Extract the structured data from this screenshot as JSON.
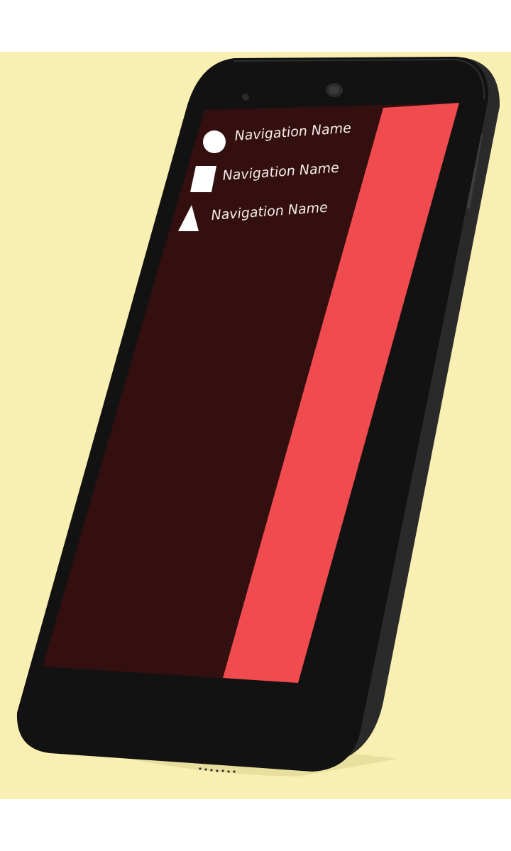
{
  "colors": {
    "background": "#faefb2",
    "phone_body": "#181818",
    "phone_edge": "#2c2c2c",
    "screen_drawer": "#330f0f",
    "screen_content": "#f04b4f",
    "icon_fill": "#ffffff",
    "label_color": "#f4eceb"
  },
  "drawer": {
    "items": [
      {
        "icon": "circle-icon",
        "label": "Navigation Name"
      },
      {
        "icon": "square-icon",
        "label": "Navigation Name"
      },
      {
        "icon": "triangle-icon",
        "label": "Navigation Name"
      }
    ]
  }
}
